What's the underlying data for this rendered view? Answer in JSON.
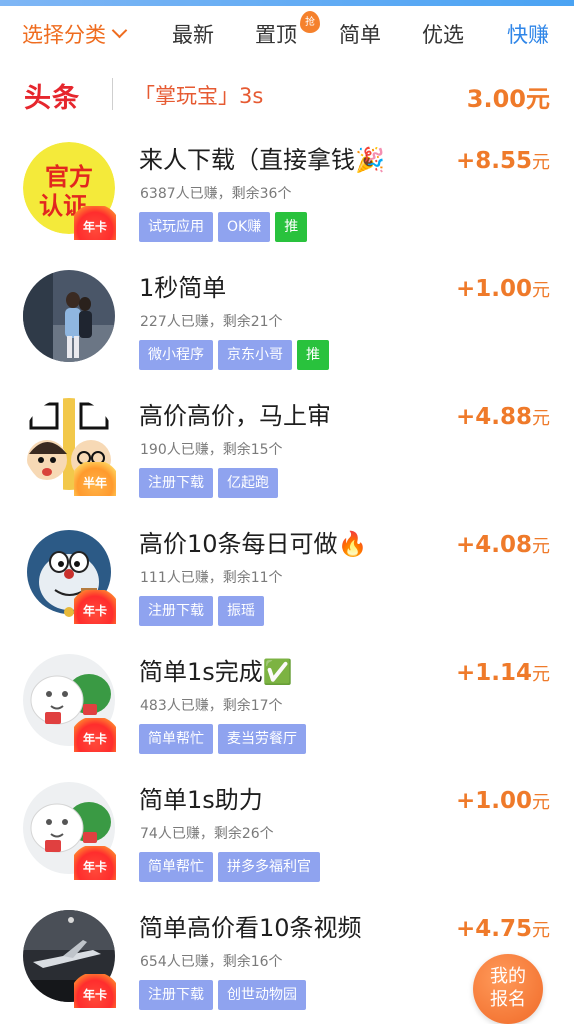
{
  "tabs": [
    {
      "label": "选择分类"
    },
    {
      "label": "最新"
    },
    {
      "label": "置顶",
      "badge": "抢"
    },
    {
      "label": "简单"
    },
    {
      "label": "优选"
    },
    {
      "label": "快赚"
    }
  ],
  "headline": {
    "logo": "头条",
    "text": "「掌玩宝」3s",
    "price": "3.00元"
  },
  "tasks": [
    {
      "title": "来人下载（直接拿钱🎉",
      "meta": "6387人已赚，剩余36个",
      "tags": [
        "试玩应用",
        "OK赚"
      ],
      "push": "推",
      "reward": "+8.55",
      "unit": "元",
      "badge": "年卡",
      "avatar_text": "官方认证"
    },
    {
      "title": "1秒简单",
      "meta": "227人已赚，剩余21个",
      "tags": [
        "微小程序",
        "京东小哥"
      ],
      "push": "推",
      "reward": "+1.00",
      "unit": "元",
      "badge": "",
      "avatar_text": ""
    },
    {
      "title": "高价高价，马上审",
      "meta": "190人已赚，剩余15个",
      "tags": [
        "注册下载",
        "亿起跑"
      ],
      "push": "",
      "reward": "+4.88",
      "unit": "元",
      "badge": "半年",
      "avatar_text": ""
    },
    {
      "title": "高价10条每日可做🔥",
      "meta": "111人已赚，剩余11个",
      "tags": [
        "注册下载",
        "振瑶"
      ],
      "push": "",
      "reward": "+4.08",
      "unit": "元",
      "badge": "年卡",
      "avatar_text": ""
    },
    {
      "title": "简单1s完成✅",
      "meta": "483人已赚，剩余17个",
      "tags": [
        "简单帮忙",
        "麦当劳餐厅"
      ],
      "push": "",
      "reward": "+1.14",
      "unit": "元",
      "badge": "年卡",
      "avatar_text": ""
    },
    {
      "title": "简单1s助力",
      "meta": "74人已赚，剩余26个",
      "tags": [
        "简单帮忙",
        "拼多多福利官"
      ],
      "push": "",
      "reward": "+1.00",
      "unit": "元",
      "badge": "年卡",
      "avatar_text": ""
    },
    {
      "title": "简单高价看10条视频",
      "meta": "654人已赚，剩余16个",
      "tags": [
        "注册下载",
        "创世动物园"
      ],
      "push": "",
      "reward": "+4.75",
      "unit": "元",
      "badge": "年卡",
      "avatar_text": ""
    }
  ],
  "float_button": {
    "line1": "我的",
    "line2": "报名"
  },
  "colors": {
    "accent": "#ef7a2a",
    "tag": "#8fa3ef",
    "push": "#29c23d",
    "link": "#2f86e8",
    "logo": "#e6262d"
  }
}
